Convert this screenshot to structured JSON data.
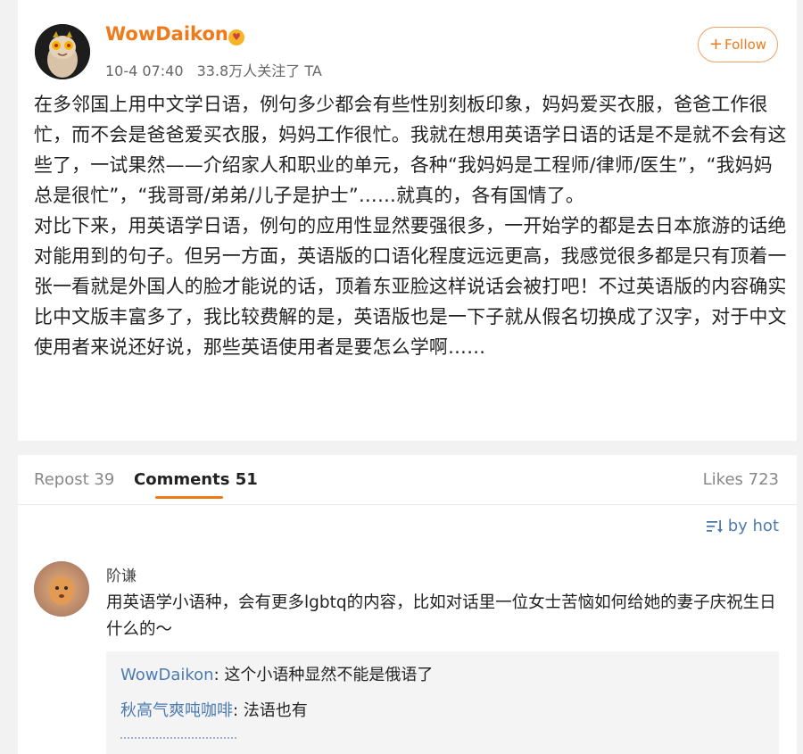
{
  "post": {
    "author": "WowDaikon",
    "date": "10-4 07:40",
    "followers": "33.8万人关注了 TA",
    "follow_label": "Follow",
    "follow_plus": "+",
    "badge_icon": "vip-emoji-icon",
    "paragraphs": [
      "在多邻国上用中文学日语，例句多少都会有些性别刻板印象，妈妈爱买衣服，爸爸工作很忙，而不会是爸爸爱买衣服，妈妈工作很忙。我就在想用英语学日语的话是不是就不会有这些了，一试果然——介绍家人和职业的单元，各种“我妈妈是工程师/律师/医生”，“我妈妈总是很忙”，“我哥哥/弟弟/儿子是护士”……就真的，各有国情了。",
      "对比下来，用英语学日语，例句的应用性显然要强很多，一开始学的都是去日本旅游的话绝对能用到的句子。但另一方面，英语版的口语化程度远远更高，我感觉很多都是只有顶着一张一看就是外国人的脸才能说的话，顶着东亚脸这样说话会被打吧！不过英语版的内容确实比中文版丰富多了，我比较费解的是，英语版也是一下子就从假名切换成了汉字，对于中文使用者来说还好说，那些英语使用者是要怎么学啊……"
    ]
  },
  "tabs": {
    "repost": "Repost 39",
    "comments": "Comments 51",
    "likes": "Likes 723"
  },
  "sort": {
    "label": "by hot",
    "icon": "sort-icon"
  },
  "comment": {
    "author": "阶谦",
    "text": "用英语学小语种，会有更多lgbtq的内容，比如对话里一位女士苦恼如何给她的妻子庆祝生日什么的～",
    "replies": [
      {
        "user": "WowDaikon",
        "sep": ": ",
        "text": "这个小语种显然不能是俄语了"
      },
      {
        "user": "秋高气爽吨咖啡",
        "sep": ": ",
        "text": "法语也有"
      }
    ]
  },
  "colors": {
    "accent": "#ee7a1a",
    "link": "#4c7bb1",
    "background": "#f2f2f2"
  }
}
